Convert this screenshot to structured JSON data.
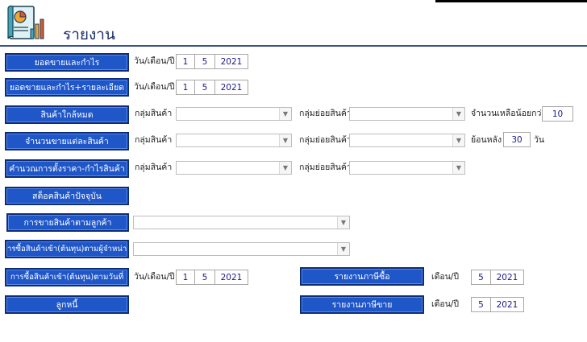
{
  "header": {
    "title": "รายงาน",
    "icon": "report-chart-icon"
  },
  "labels": {
    "date": "วัน/เดือน/ปี",
    "month": "เดือน/ปี",
    "product_group": "กลุ่มสินค้า",
    "sub_group": "กลุ่มย่อยสินค้า",
    "remaining_less": "จำนวนเหลือน้อยกว่า",
    "back": "ย้อนหลัง",
    "days": "วัน"
  },
  "rows": {
    "sales_profit": {
      "label": "ยอดขายและกำไร",
      "day": "1",
      "month": "5",
      "year": "2021"
    },
    "sales_profit_detail": {
      "label": "ยอดขายและกำไร+รายละเอียด",
      "day": "1",
      "month": "5",
      "year": "2021"
    },
    "near_out": {
      "label": "สินค้าใกล้หมด",
      "threshold": "10"
    },
    "sales_qty": {
      "label": "จำนวนขายแต่ละสินค้า",
      "days_back": "30"
    },
    "pricing": {
      "label": "คำนวณการตั้งราคา-กำไรสินค้า"
    },
    "stock": {
      "label": "สต็อคสินค้าปัจจุบัน"
    },
    "by_customer": {
      "label": "การขายสินค้าตามลูกค้า"
    },
    "by_supplier": {
      "label": "การซื้อสินค้าเข้า(ต้นทุน)ตามผู้จำหน่าย"
    },
    "by_date": {
      "label": "การซื้อสินค้าเข้า(ต้นทุน)ตามวันที่",
      "day": "1",
      "month": "5",
      "year": "2021"
    },
    "purchase_tax": {
      "label": "รายงานภาษีซื้อ",
      "month": "5",
      "year": "2021"
    },
    "debtors": {
      "label": "ลูกหนี้"
    },
    "sales_tax": {
      "label": "รายงานภาษีขาย",
      "month": "5",
      "year": "2021"
    }
  }
}
